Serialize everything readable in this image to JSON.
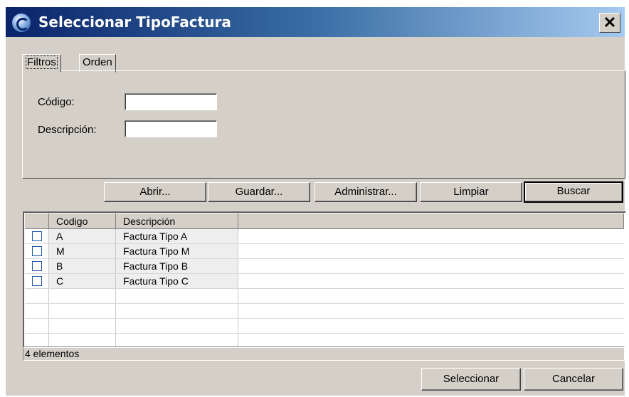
{
  "window": {
    "title": "Seleccionar TipoFactura",
    "close_label": "✕"
  },
  "tabs": [
    {
      "label": "Filtros"
    },
    {
      "label": "Orden"
    }
  ],
  "filters": {
    "codigo_label": "Código:",
    "codigo_value": "",
    "descripcion_label": "Descripción:",
    "descripcion_value": ""
  },
  "buttons": {
    "abrir": "Abrir...",
    "guardar": "Guardar...",
    "administrar": "Administrar...",
    "limpiar": "Limpiar",
    "buscar": "Buscar"
  },
  "table": {
    "headers": [
      "Codigo",
      "Descripción"
    ],
    "rows": [
      {
        "codigo": "A",
        "descripcion": "Factura Tipo A",
        "checked": false
      },
      {
        "codigo": "M",
        "descripcion": "Factura Tipo M",
        "checked": false
      },
      {
        "codigo": "B",
        "descripcion": "Factura Tipo B",
        "checked": false
      },
      {
        "codigo": "C",
        "descripcion": "Factura Tipo C",
        "checked": false
      }
    ]
  },
  "status": {
    "count_text": "4 elementos"
  },
  "footer": {
    "seleccionar": "Seleccionar",
    "cancelar": "Cancelar"
  }
}
